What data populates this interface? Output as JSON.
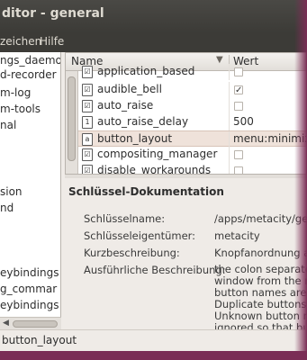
{
  "window": {
    "title": "ditor - general",
    "menus": [
      "zeichen",
      "Hilfe"
    ]
  },
  "tree": {
    "items_top": [
      "ngs_daemo",
      "d-recorder",
      "m-log",
      "m-tools",
      "nal"
    ],
    "items_mid": [
      "sion",
      "nd"
    ],
    "items_bottom": [
      "eybindings",
      "g_commar",
      "eybindings"
    ]
  },
  "list": {
    "header_name": "Name",
    "header_value": "Wert",
    "rows": [
      {
        "name": "application_based",
        "type": "checkbox",
        "checked": false,
        "value": ""
      },
      {
        "name": "audible_bell",
        "type": "checkbox",
        "checked": true,
        "value": ""
      },
      {
        "name": "auto_raise",
        "type": "checkbox",
        "checked": false,
        "value": ""
      },
      {
        "name": "auto_raise_delay",
        "type": "text",
        "value": "500"
      },
      {
        "name": "button_layout",
        "type": "text",
        "value": "menu:minimize",
        "selected": true
      },
      {
        "name": "compositing_manager",
        "type": "checkbox",
        "checked": false,
        "value": ""
      },
      {
        "name": "disable_workarounds",
        "type": "checkbox",
        "checked": false,
        "value": ""
      }
    ]
  },
  "doc": {
    "title": "Schlüssel-Dokumentation",
    "key_name_label": "Schlüsselname:",
    "key_name_value": "/apps/metacity/gene",
    "owner_label": "Schlüsseleigentümer:",
    "owner_value": "metacity",
    "short_label": "Kurzbeschreibung:",
    "short_value": "Knopfanordnung au",
    "long_label": "Ausführliche Beschreibung:",
    "long_lines": [
      "the colon separates",
      "window from the rig",
      "button names are c",
      "Duplicate buttons a",
      "Unknown button na",
      "ignored so that butt"
    ]
  },
  "status": {
    "text": "button_layout"
  }
}
